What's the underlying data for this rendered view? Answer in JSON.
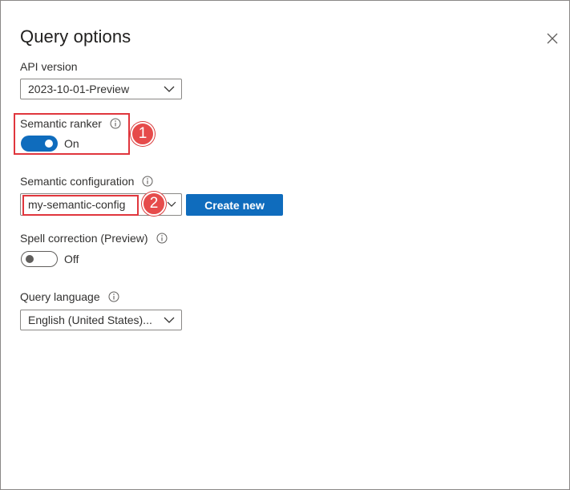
{
  "panel": {
    "title": "Query options",
    "close_icon": "close-icon"
  },
  "api_version": {
    "label": "API version",
    "selected": "2023-10-01-Preview"
  },
  "semantic_ranker": {
    "label": "Semantic ranker",
    "state": "On",
    "enabled": true
  },
  "semantic_configuration": {
    "label": "Semantic configuration",
    "selected": "my-semantic-config",
    "create_button": "Create new"
  },
  "spell_correction": {
    "label": "Spell correction (Preview)",
    "state": "Off",
    "enabled": false
  },
  "query_language": {
    "label": "Query language",
    "selected": "English (United States)..."
  },
  "callouts": [
    {
      "number": "1"
    },
    {
      "number": "2"
    }
  ],
  "colors": {
    "accent": "#0f6cbd",
    "callout": "#e64b4b",
    "border": "#8a8886"
  }
}
